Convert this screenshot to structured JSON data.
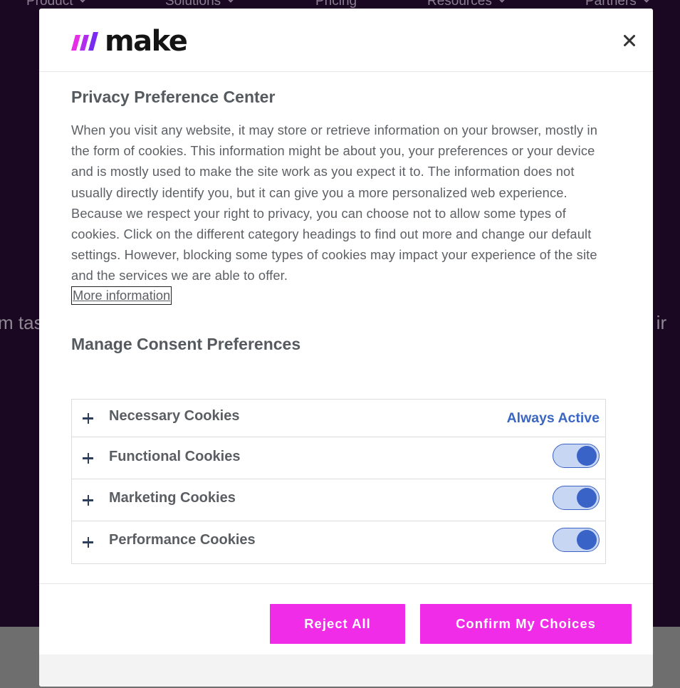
{
  "background": {
    "nav": [
      {
        "label": "Product",
        "has_chevron": true
      },
      {
        "label": "Solutions",
        "has_chevron": true
      },
      {
        "label": "Pricing",
        "has_chevron": false
      },
      {
        "label": "Resources",
        "has_chevron": true
      },
      {
        "label": "Partners",
        "has_chevron": true
      }
    ],
    "left_fragment": "m tas",
    "right_fragment": "g ir"
  },
  "modal": {
    "logo_text": "make",
    "close_icon": "close-icon",
    "title": "Privacy Preference Center",
    "description": "When you visit any website, it may store or retrieve information on your browser, mostly in the form of cookies. This information might be about you, your preferences or your device and is mostly used to make the site work as you expect it to. The information does not usually directly identify you, but it can give you a more personalized web experience. Because we respect your right to privacy, you can choose not to allow some types of cookies. Click on the different category headings to find out more and change our default settings. However, blocking some types of cookies may impact your experience of the site and the services we are able to offer.",
    "more_info": "More information",
    "manage_title": "Manage Consent Preferences",
    "categories": [
      {
        "label": "Necessary Cookies",
        "status": "Always Active"
      },
      {
        "label": "Functional Cookies",
        "enabled": true
      },
      {
        "label": "Marketing Cookies",
        "enabled": true
      },
      {
        "label": "Performance Cookies",
        "enabled": true
      }
    ],
    "reject_all": "Reject All",
    "confirm": "Confirm My Choices"
  },
  "colors": {
    "accent_button": "#f02ce8",
    "toggle_on": "#3a63c8",
    "always_active": "#3a66c4",
    "backdrop": "#1a0722"
  }
}
